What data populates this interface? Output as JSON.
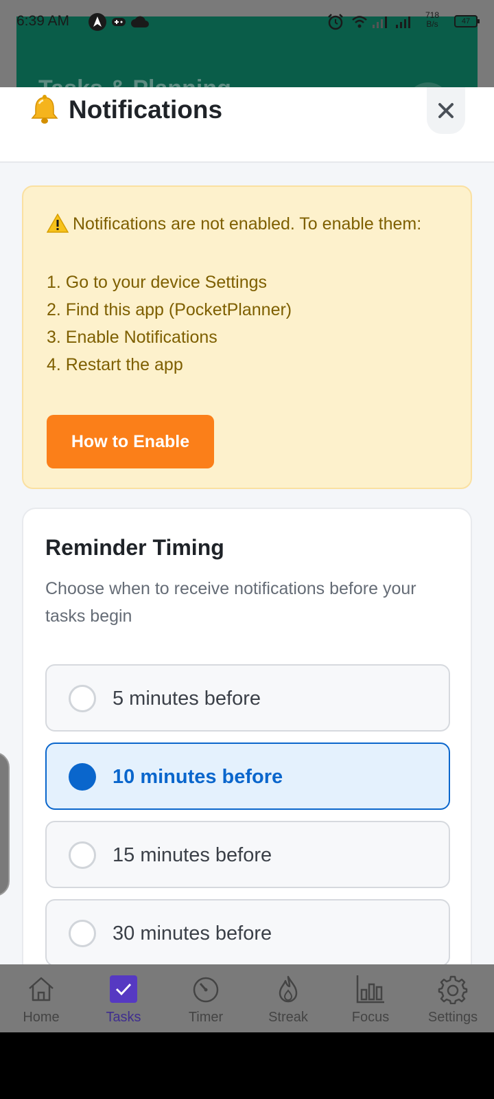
{
  "status_bar": {
    "time": "6:39 AM",
    "net_speed_value": "718",
    "net_speed_unit": "B/s",
    "battery": "47",
    "icons": [
      "navigation-icon",
      "gamepad-icon",
      "cloud-icon",
      "alarm-icon",
      "wifi-icon",
      "signal-icon",
      "signal-icon",
      "battery-icon"
    ]
  },
  "background": {
    "title": "Tasks & Planning"
  },
  "modal": {
    "title": "Notifications",
    "icon": "bell-icon",
    "close_label": "×"
  },
  "warning": {
    "icon": "warning-icon",
    "lines": [
      "Notifications are not enabled. To enable them:",
      "",
      "1. Go to your device Settings",
      "2. Find this app (PocketPlanner)",
      "3. Enable Notifications",
      "4. Restart the app"
    ],
    "button_label": "How to Enable"
  },
  "reminder": {
    "title": "Reminder Timing",
    "description": "Choose when to receive notifications before your tasks begin",
    "options": [
      {
        "label": "5 minutes before",
        "selected": false
      },
      {
        "label": "10 minutes before",
        "selected": true
      },
      {
        "label": "15 minutes before",
        "selected": false
      },
      {
        "label": "30 minutes before",
        "selected": false
      }
    ]
  },
  "bottom_nav": {
    "items": [
      {
        "label": "Home",
        "icon": "home-icon",
        "active": false
      },
      {
        "label": "Tasks",
        "icon": "tasks-check-icon",
        "active": true
      },
      {
        "label": "Timer",
        "icon": "timer-icon",
        "active": false
      },
      {
        "label": "Streak",
        "icon": "flame-icon",
        "active": false
      },
      {
        "label": "Focus",
        "icon": "bar-chart-icon",
        "active": false
      },
      {
        "label": "Settings",
        "icon": "gear-icon",
        "active": false
      }
    ]
  },
  "colors": {
    "accent": "#0a66cc",
    "warning_bg": "#fdf1cc",
    "warning_text": "#7e5f00",
    "button_orange": "#fb7f19",
    "active_nav": "#5639c2"
  }
}
